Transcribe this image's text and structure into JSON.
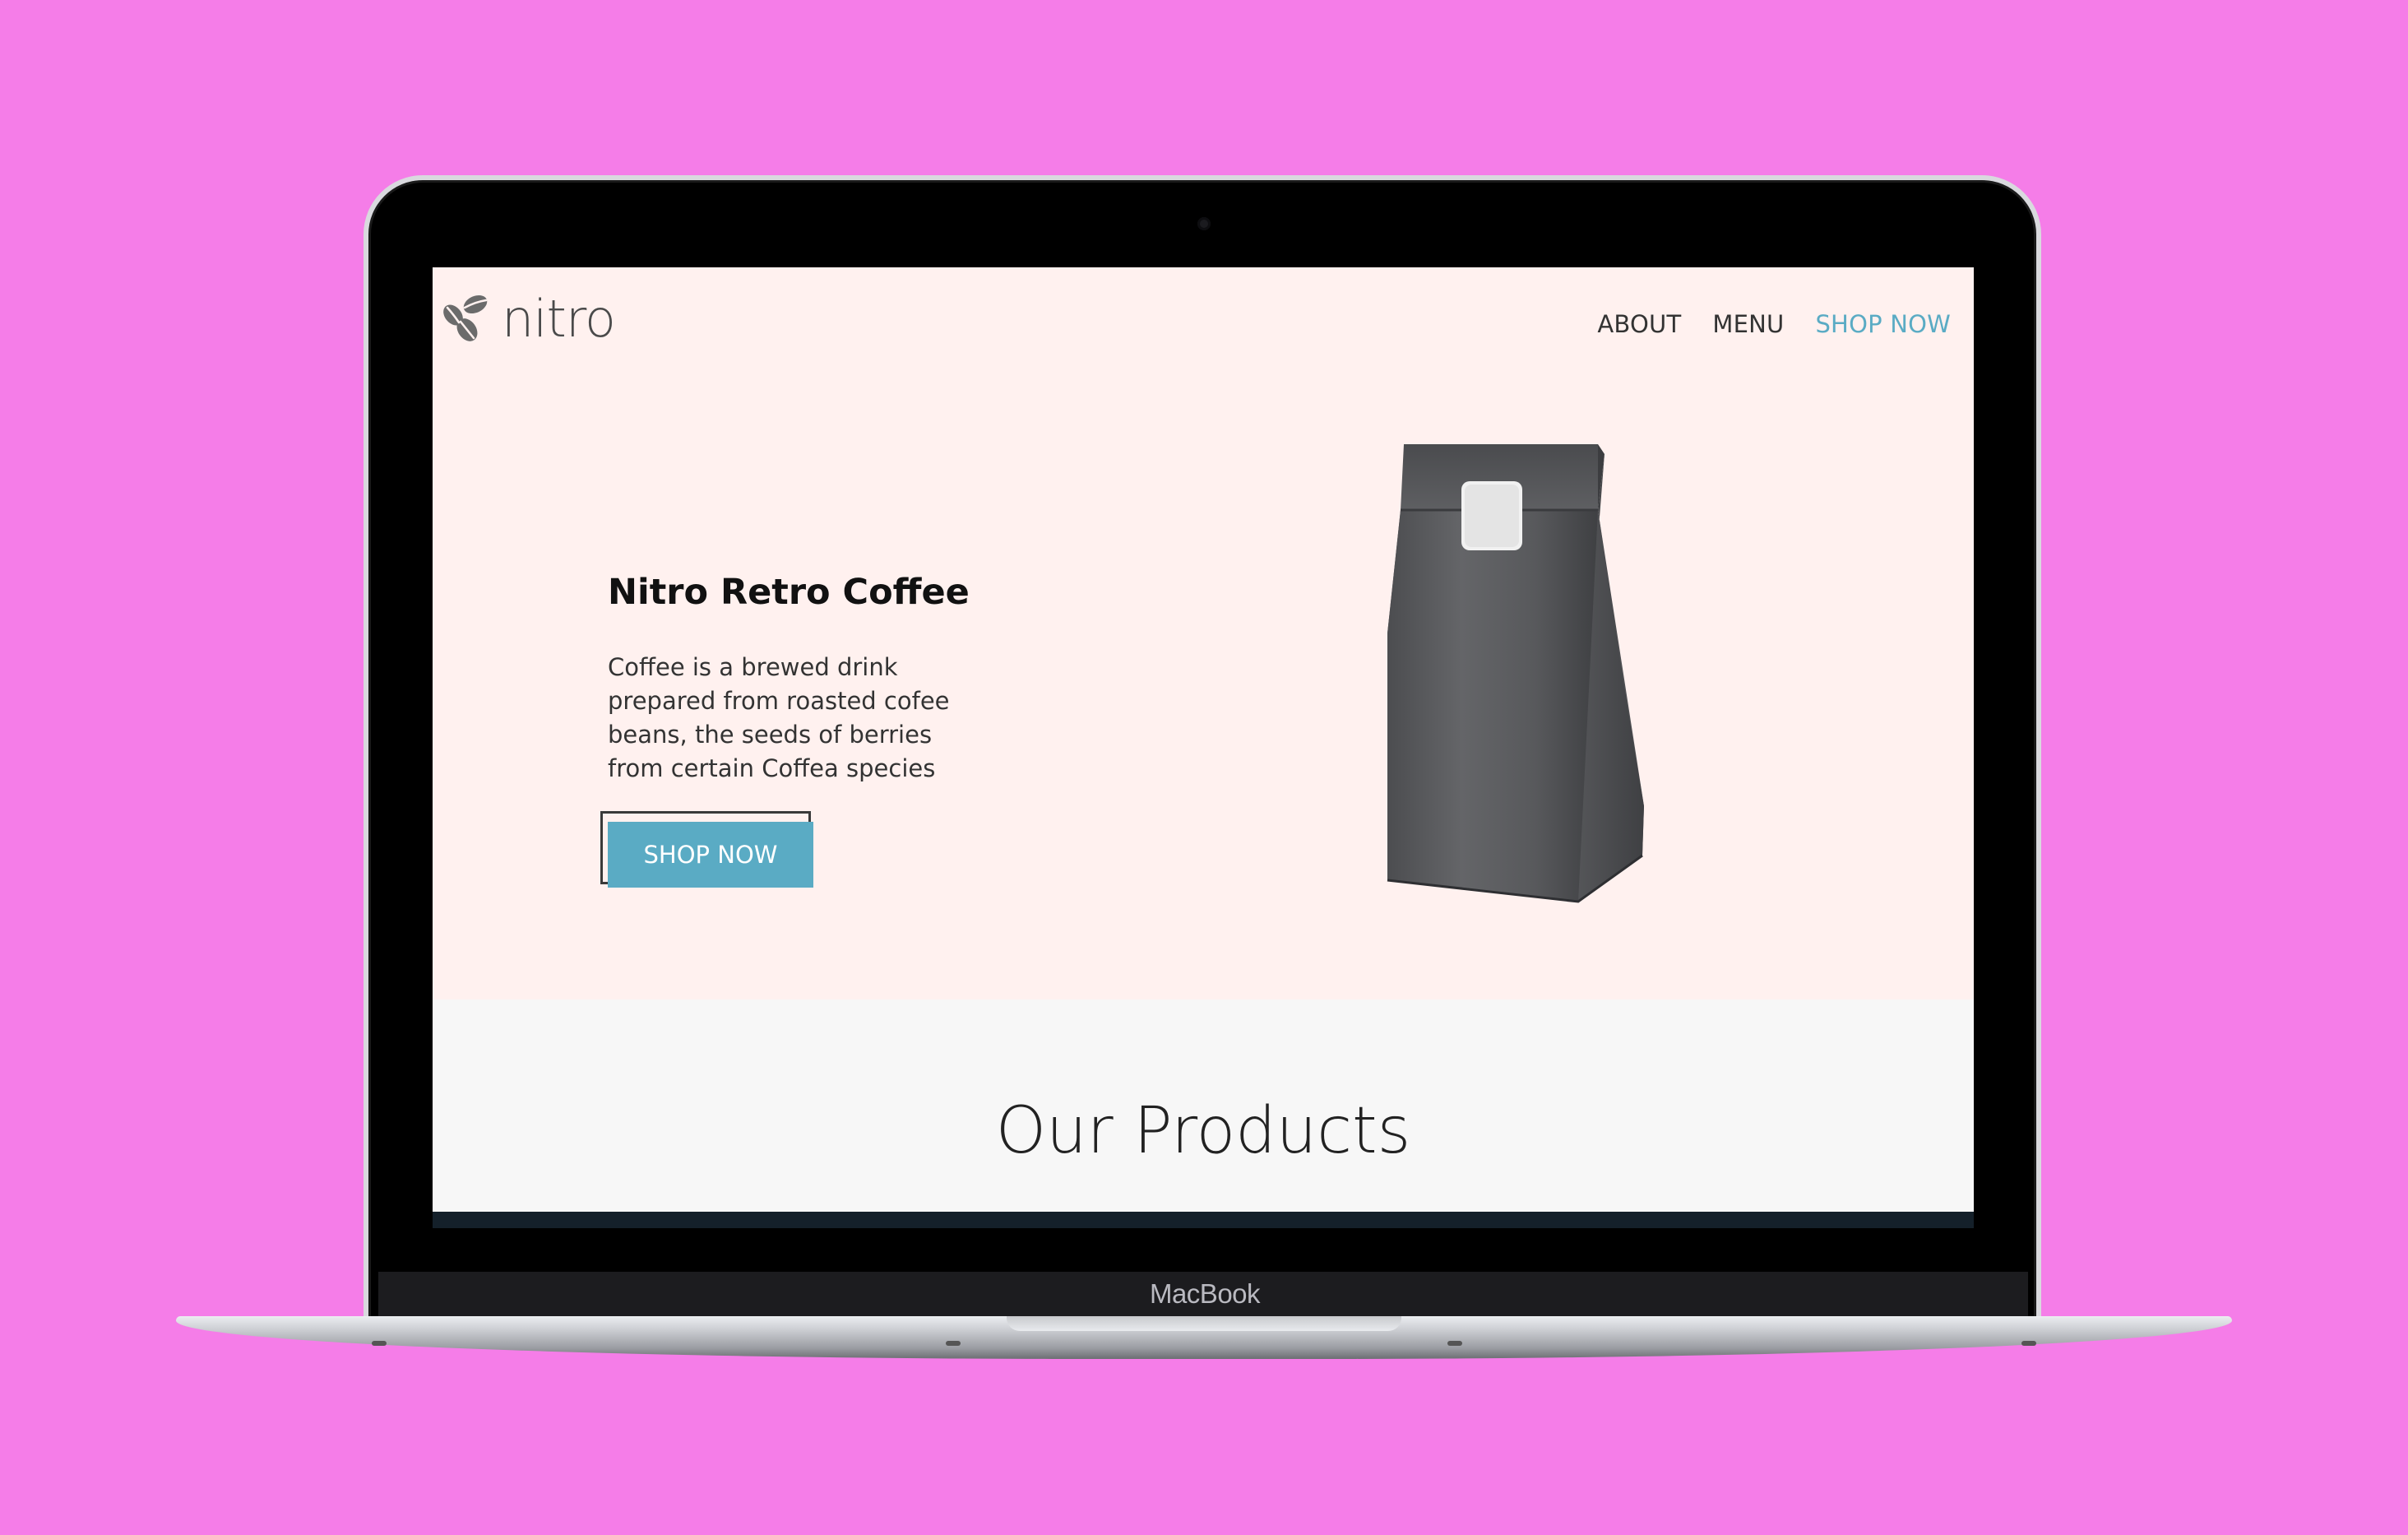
{
  "device": {
    "brand_label": "MacBook"
  },
  "site": {
    "logo": {
      "text": "nitro",
      "icon": "coffee-beans-icon"
    },
    "nav": {
      "items": [
        {
          "label": "ABOUT",
          "active": false
        },
        {
          "label": "MENU",
          "active": false
        },
        {
          "label": "SHOP NOW",
          "active": true
        }
      ]
    },
    "hero": {
      "title": "Nitro Retro Coffee",
      "description": "Coffee is a brewed drink prepared from roasted cofee beans, the seeds of berries from certain Coffea species",
      "cta_label": "SHOP NOW",
      "image": "coffee-bag-icon"
    },
    "products": {
      "heading": "Our Products"
    }
  },
  "colors": {
    "page_background": "#f57de8",
    "hero_background": "#fff1ef",
    "section_background": "#f7f7f7",
    "accent": "#5aabc4",
    "text_dark": "#111111"
  }
}
